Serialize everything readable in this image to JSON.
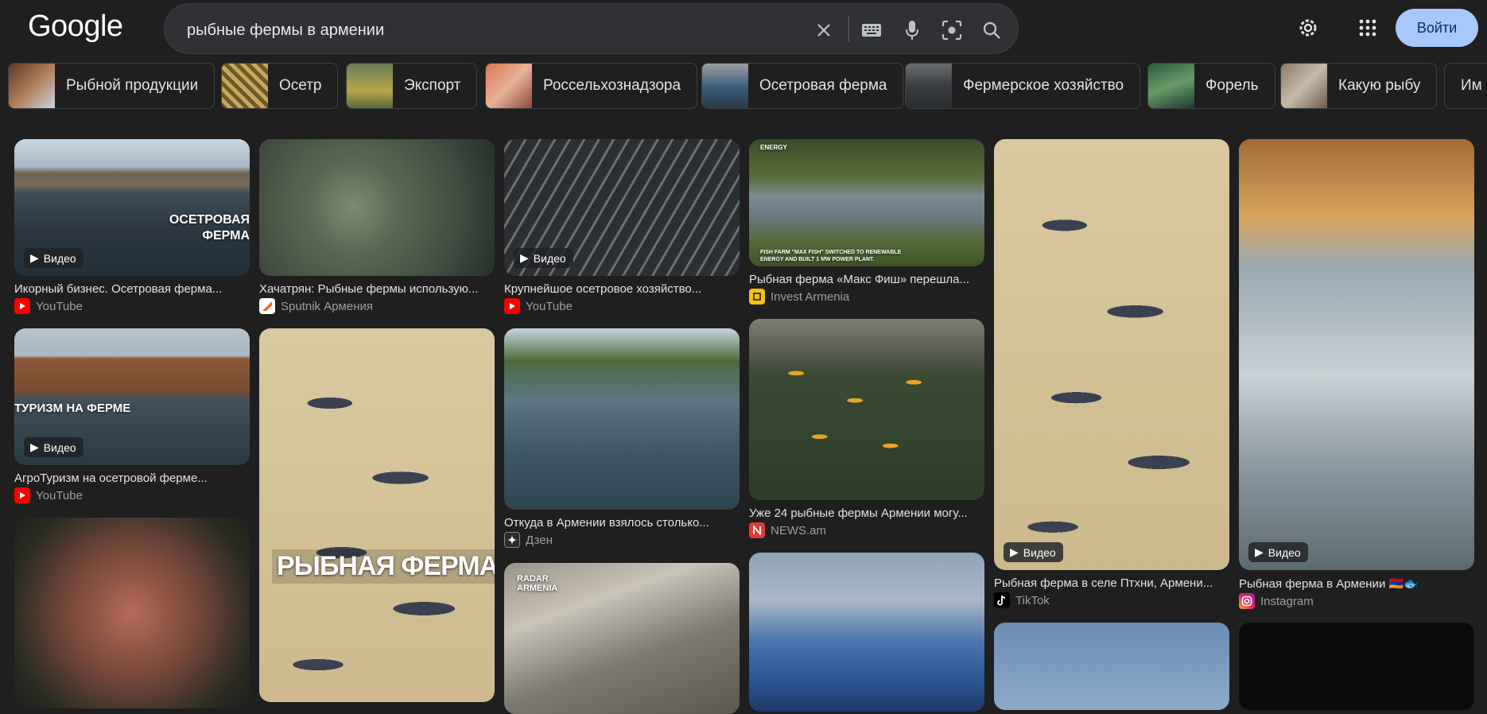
{
  "header": {
    "logo": "Google",
    "search_query": "рыбные фермы в армении",
    "signin_label": "Войти"
  },
  "icons": {
    "clear": "close-icon",
    "keyboard": "keyboard-icon",
    "voice": "mic-icon",
    "lens": "camera-lens-icon",
    "search": "search-icon",
    "settings": "gear-icon",
    "apps": "apps-grid-icon"
  },
  "chips": [
    "Рыбной продукции",
    "Осетр",
    "Экспорт",
    "Россельхознадзора",
    "Осетровая ферма",
    "Фермерское хозяйство",
    "Форель",
    "Какую рыбу",
    "Им"
  ],
  "video_badge": "Видео",
  "results": [
    {
      "title": "Икорный бизнес. Осетровая ферма...",
      "source": "YouTube",
      "overlay": "ОСЕТРОВАЯ ФЕРМА"
    },
    {
      "title": "Хачатрян: Рыбные фермы использую...",
      "source": "Sputnik Армения"
    },
    {
      "title": "Крупнейшое осетровое хозяйство...",
      "source": "YouTube"
    },
    {
      "title": "Рыбная ферма «Макс Фиш» перешла...",
      "source": "Invest Armenia",
      "overlay_top": "ENERGY",
      "caption": "FISH FARM \"MAX FISH\" SWITCHED TO RENEWABLE ENERGY AND BUILT 1 MW POWER PLANT."
    },
    {
      "title": "Рыбная ферма в селе Птхни, Армени...",
      "source": "TikTok"
    },
    {
      "title": "Рыбная ферма в Армении 🇦🇲🐟",
      "source": "Instagram"
    },
    {
      "title": "АгроТуризм на осетровой ферме...",
      "source": "YouTube",
      "overlay": "ТУРИЗМ НА ФЕРМЕ"
    },
    {
      "title": "",
      "source": "",
      "overlay": "РЫБНАЯ ФЕРМА"
    },
    {
      "title": "Откуда в Армении взялось столько...",
      "source": "Дзен"
    },
    {
      "title": "Уже 24 рыбные фермы Армении могу...",
      "source": "NEWS.am"
    },
    {
      "title": "",
      "source": "",
      "overlay": "RADAR ARMENIA"
    }
  ]
}
